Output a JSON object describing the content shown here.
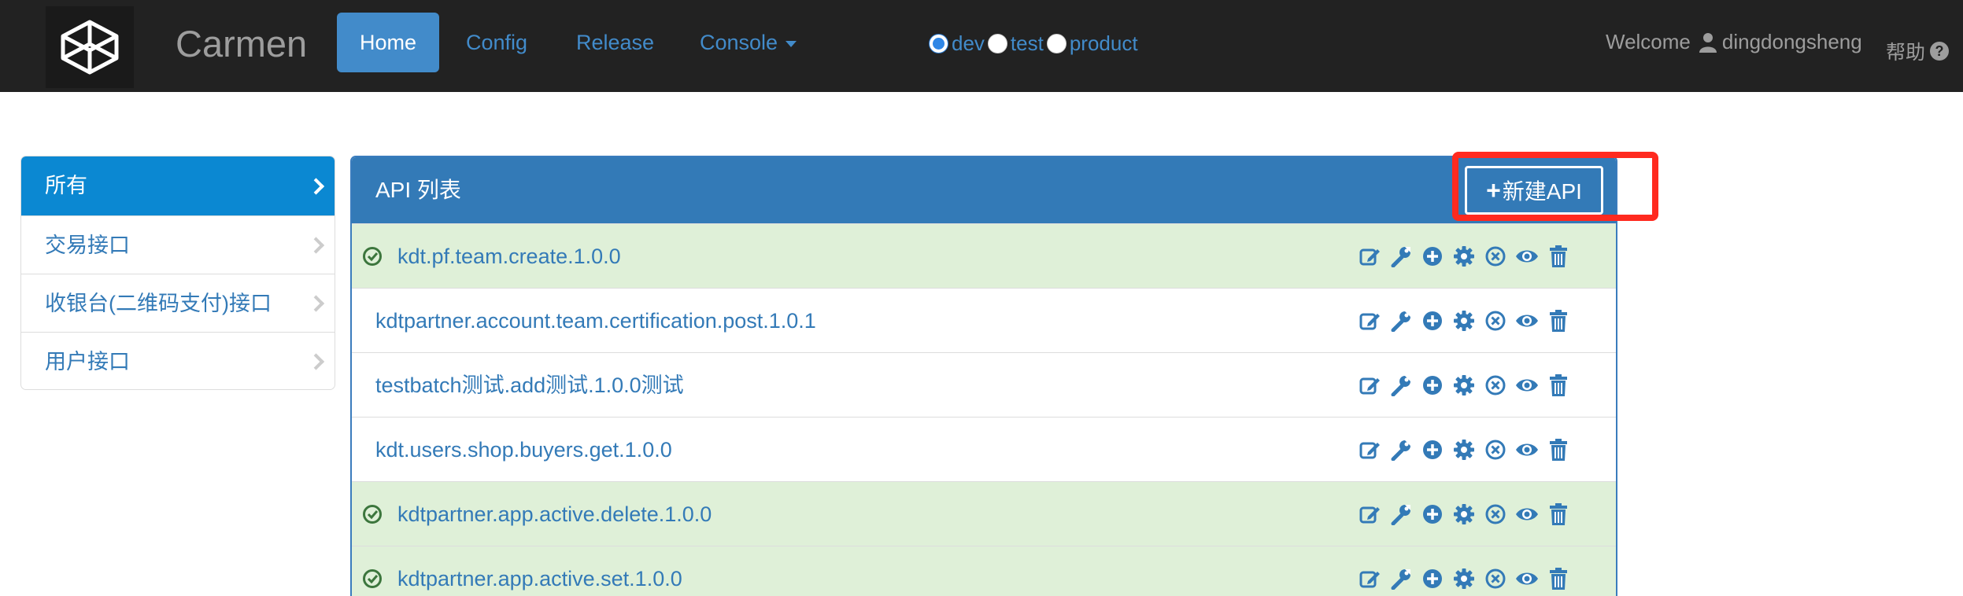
{
  "navbar": {
    "brand": "Carmen",
    "items": [
      {
        "label": "Home",
        "active": true
      },
      {
        "label": "Config",
        "active": false
      },
      {
        "label": "Release",
        "active": false
      },
      {
        "label": "Console",
        "active": false,
        "dropdown": true
      }
    ],
    "environments": [
      {
        "label": "dev",
        "checked": true
      },
      {
        "label": "test",
        "checked": false
      },
      {
        "label": "product",
        "checked": false
      }
    ],
    "welcome_label": "Welcome",
    "username": "dingdongsheng",
    "help_label": "帮助",
    "help_icon": "?"
  },
  "sidebar": {
    "items": [
      {
        "label": "所有",
        "active": true
      },
      {
        "label": "交易接口",
        "active": false
      },
      {
        "label": "收银台(二维码支付)接口",
        "active": false
      },
      {
        "label": "用户接口",
        "active": false
      }
    ]
  },
  "panel": {
    "title": "API 列表",
    "new_button_plus": "+",
    "new_button_label": "新建API",
    "rows": [
      {
        "name": "kdt.pf.team.create.1.0.0",
        "status": "success"
      },
      {
        "name": "kdtpartner.account.team.certification.post.1.0.1",
        "status": "default"
      },
      {
        "name": "testbatch测试.add测试.1.0.0测试",
        "status": "default"
      },
      {
        "name": "kdt.users.shop.buyers.get.1.0.0",
        "status": "default"
      },
      {
        "name": "kdtpartner.app.active.delete.1.0.0",
        "status": "success"
      },
      {
        "name": "kdtpartner.app.active.set.1.0.0",
        "status": "success"
      }
    ],
    "row_actions": [
      "edit-icon",
      "wrench-icon",
      "plus-circle-icon",
      "gear-icon",
      "remove-circle-icon",
      "eye-icon",
      "trash-icon"
    ]
  },
  "colors": {
    "navbar_bg": "#222222",
    "primary": "#337ab7",
    "success_row": "#dff0d8",
    "highlight": "#ff2a1f"
  }
}
